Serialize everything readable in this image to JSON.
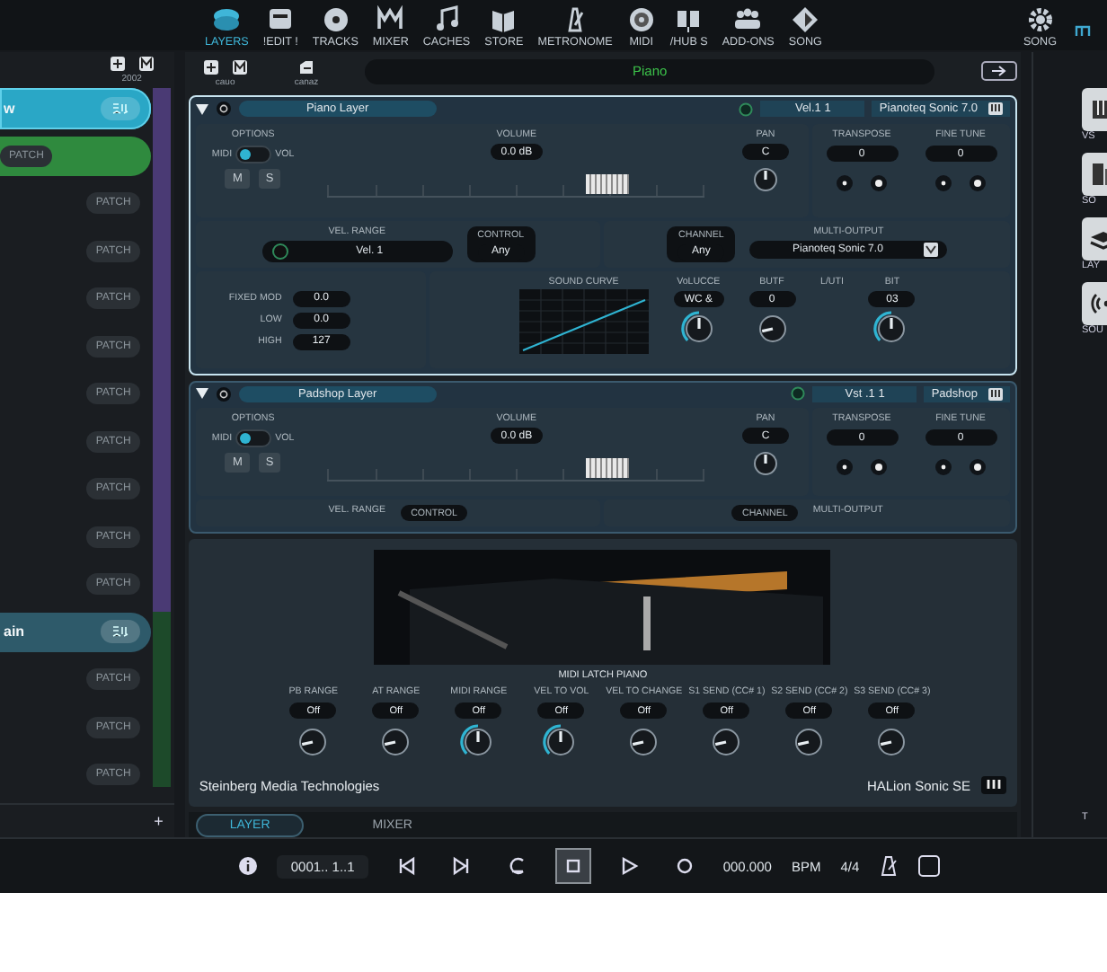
{
  "nav": {
    "items": [
      {
        "label": "LAYERS",
        "selected": true
      },
      {
        "label": "!EDIT !",
        "selected": false
      },
      {
        "label": "TRACKS",
        "selected": false
      },
      {
        "label": "MIXER",
        "selected": false
      },
      {
        "label": "CACHES",
        "selected": false
      },
      {
        "label": "STORE",
        "selected": false
      },
      {
        "label": "METRONOME",
        "selected": false
      },
      {
        "label": "MIDI",
        "selected": false
      },
      {
        "label": "/HUB S",
        "selected": false
      },
      {
        "label": "ADD-ONS",
        "selected": false
      },
      {
        "label": "SONG",
        "selected": false
      }
    ],
    "settings_label": "SONG"
  },
  "sidebar": {
    "caption": "2002",
    "items": [
      {
        "kind": "channel",
        "name": "w",
        "selected": true,
        "color": "#2aa7c6"
      },
      {
        "kind": "patch",
        "badge": "PATCH",
        "selected": false,
        "color": "#2f8a3e"
      },
      {
        "kind": "patch",
        "badge": "PATCH",
        "selected": false
      },
      {
        "kind": "patch",
        "badge": "PATCH",
        "selected": false
      },
      {
        "kind": "patch",
        "badge": "PATCH",
        "selected": false
      },
      {
        "kind": "patch",
        "badge": "PATCH",
        "selected": false
      },
      {
        "kind": "patch",
        "badge": "PATCH",
        "selected": false
      },
      {
        "kind": "patch",
        "badge": "PATCH",
        "selected": false
      },
      {
        "kind": "patch",
        "badge": "PATCH",
        "selected": false
      },
      {
        "kind": "patch",
        "badge": "PATCH",
        "selected": false
      },
      {
        "kind": "patch",
        "badge": "PATCH",
        "selected": false
      },
      {
        "kind": "channel",
        "name": "ain",
        "selected": false,
        "color": "#2e5a6a"
      },
      {
        "kind": "patch",
        "badge": "PATCH",
        "selected": false
      },
      {
        "kind": "patch",
        "badge": "PATCH",
        "selected": false
      },
      {
        "kind": "patch",
        "badge": "PATCH",
        "selected": false
      }
    ],
    "add": "+"
  },
  "main": {
    "tools": [
      {
        "label": "cauo"
      },
      {
        "label": "canaz"
      }
    ],
    "preset": "Piano",
    "layers": [
      {
        "name": "Piano Layer",
        "expanded": true,
        "vst": "Vel.1 1",
        "instrument": "Pianoteq Sonic 7.0",
        "options_label": "OPTIONS",
        "toggle_left": "MIDI",
        "toggle_right": "VOL",
        "toggle_on": true,
        "mute": "M",
        "solo": "S",
        "volume_label": "VOLUME",
        "volume": "0.0 dB",
        "level": 0.74,
        "pan_label": "PAN",
        "pan": "C",
        "transpose_label": "TRANSPOSE",
        "transpose": "0",
        "fine_label": "FINE TUNE",
        "fine": "0",
        "routing": [
          {
            "kind": "range",
            "label": "VEL. RANGE",
            "value": "Vel. 1"
          },
          {
            "kind": "pill",
            "label": "CONTROL",
            "value": "Any"
          },
          {
            "kind": "pill",
            "label": "CHANNEL",
            "value": "Any"
          },
          {
            "kind": "output",
            "label": "MULTI-OUTPUT",
            "value": "Pianoteq Sonic 7.0"
          }
        ],
        "mod": [
          {
            "label": "FIXED MOD",
            "value": "0.0"
          },
          {
            "label": "LOW",
            "value": "0.0"
          },
          {
            "label": "HIGH",
            "value": "127"
          }
        ],
        "curve_label": "SOUND CURVE",
        "params": [
          {
            "kind": "knob",
            "label": "VoLUCCE",
            "value": "WC &",
            "lit": true
          },
          {
            "kind": "knob",
            "label": "BUTF",
            "value": "0",
            "lit": false
          },
          {
            "kind": "label",
            "label": "L/UTI"
          },
          {
            "kind": "knob",
            "label": "BIT",
            "value": "03",
            "lit": true
          }
        ]
      },
      {
        "name": "Padshop Layer",
        "expanded": true,
        "vst": "Vst .1 1",
        "instrument": "Padshop",
        "options_label": "OPTIONS",
        "toggle_left": "MIDI",
        "toggle_right": "VOL",
        "toggle_on": true,
        "mute": "M",
        "solo": "S",
        "volume_label": "VOLUME",
        "volume": "0.0 dB",
        "level": 0.74,
        "pan_label": "PAN",
        "pan": "C",
        "transpose_label": "TRANSPOSE",
        "transpose": "0",
        "fine_label": "FINE TUNE",
        "fine": "0",
        "routing": [
          {
            "kind": "range",
            "label": "VEL. RANGE"
          },
          {
            "kind": "pill",
            "label": "CONTROL"
          },
          {
            "kind": "pill",
            "label": "CHANNEL"
          },
          {
            "kind": "output",
            "label": "MULTI-OUTPUT"
          }
        ]
      }
    ],
    "instrument": {
      "caption": "MIDI LATCH PIANO",
      "controls": [
        {
          "label": "PB RANGE",
          "value": "Off",
          "lit": false
        },
        {
          "label": "AT RANGE",
          "value": "Off",
          "lit": false
        },
        {
          "label": "MIDI RANGE",
          "value": "Off",
          "lit": true
        },
        {
          "label": "VEL TO VOL",
          "value": "Off",
          "lit": true
        },
        {
          "label": "VEL TO CHANGE",
          "value": "Off",
          "lit": false
        },
        {
          "label": "S1 SEND (CC# 1)",
          "value": "Off",
          "lit": false
        },
        {
          "label": "S2 SEND (CC# 2)",
          "value": "Off",
          "lit": false
        },
        {
          "label": "S3 SEND (CC# 3)",
          "value": "Off",
          "lit": false
        }
      ],
      "vendor": "Steinberg Media Technologies",
      "product": "HALion Sonic SE"
    },
    "tabs": [
      {
        "label": "LAYER",
        "selected": true
      },
      {
        "label": "MIXER",
        "selected": false
      }
    ]
  },
  "right_panel": {
    "tiles": [
      {
        "label": "VS"
      },
      {
        "label": "SO"
      },
      {
        "label": "LAY"
      },
      {
        "label": "SOU"
      }
    ],
    "footer": "T"
  },
  "transport": {
    "position": "0001.. 1..1",
    "buttons": [
      {
        "kind": "prev",
        "selected": false
      },
      {
        "kind": "next",
        "selected": false
      },
      {
        "kind": "cycle",
        "selected": false
      },
      {
        "kind": "stop",
        "selected": true
      },
      {
        "kind": "play",
        "selected": false
      },
      {
        "kind": "record",
        "selected": false
      }
    ],
    "tempo": "000.000",
    "tempo_unit": "BPM",
    "signature": "4/4"
  }
}
